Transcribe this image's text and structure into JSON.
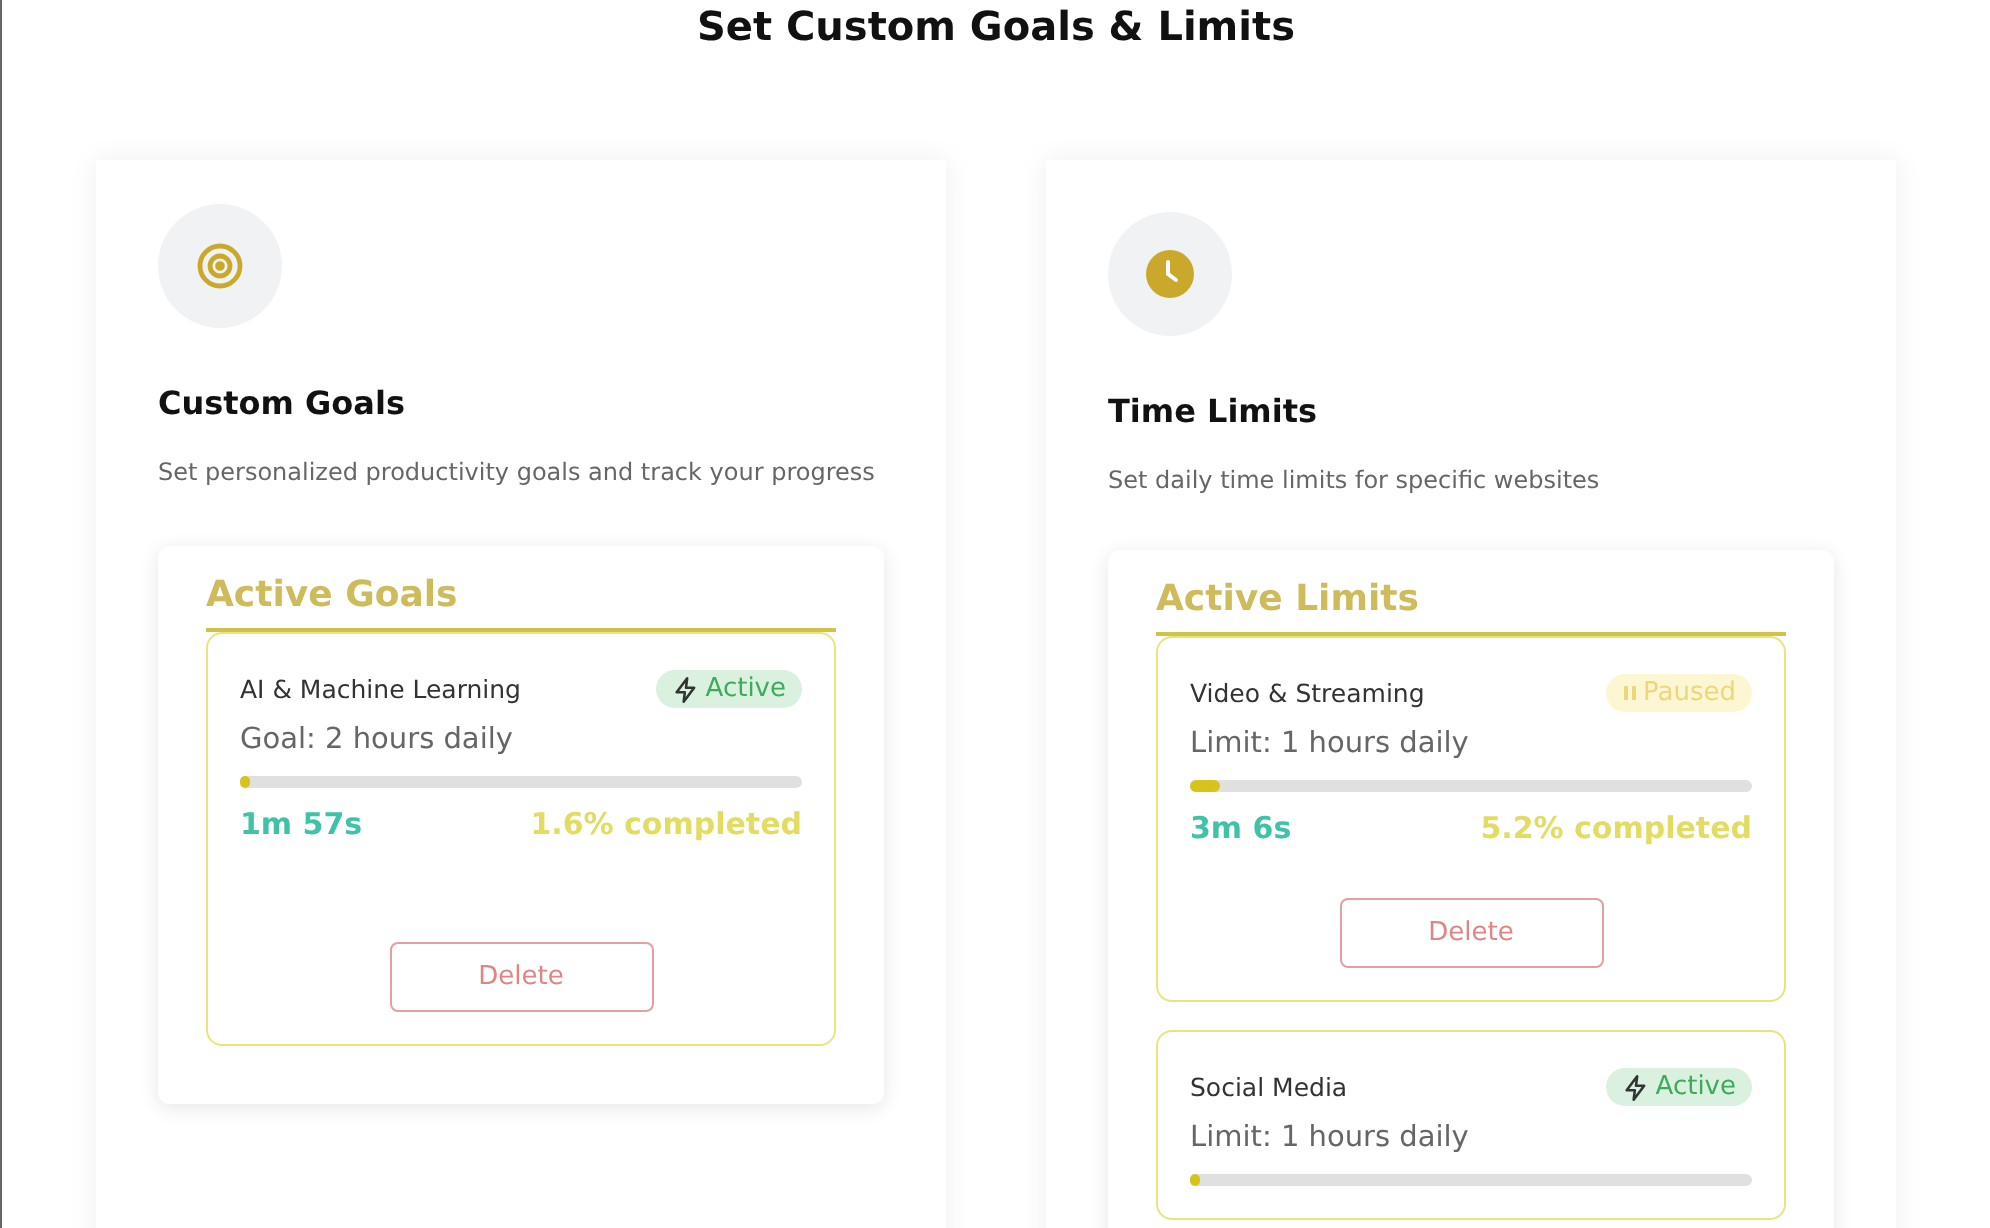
{
  "title": "Set Custom Goals & Limits",
  "cards": [
    {
      "kind": "target",
      "title": "Custom Goals",
      "description": "Set personalized productivity goals and track your progress",
      "panel": {
        "heading": "Active Goals",
        "items": [
          {
            "name": "AI & Machine Learning",
            "kind": "active",
            "status_label": "Active",
            "target": "Goal: 2 hours daily",
            "level": 0.016,
            "time": "1m 57s",
            "percent": "1.6% completed",
            "action": "Delete"
          }
        ]
      }
    },
    {
      "kind": "clock",
      "title": "Time Limits",
      "description": "Set daily time limits for specific websites",
      "panel": {
        "heading": "Active Limits",
        "items": [
          {
            "name": "Video & Streaming",
            "kind": "paused",
            "status_label": "Paused",
            "target": "Limit: 1 hours daily",
            "level": 0.052,
            "time": "3m 6s",
            "percent": "5.2% completed",
            "action": "Delete"
          },
          {
            "name": "Social Media",
            "kind": "active",
            "status_label": "Active",
            "target": "Limit: 1 hours daily",
            "level": 0.01
          }
        ]
      }
    }
  ]
}
